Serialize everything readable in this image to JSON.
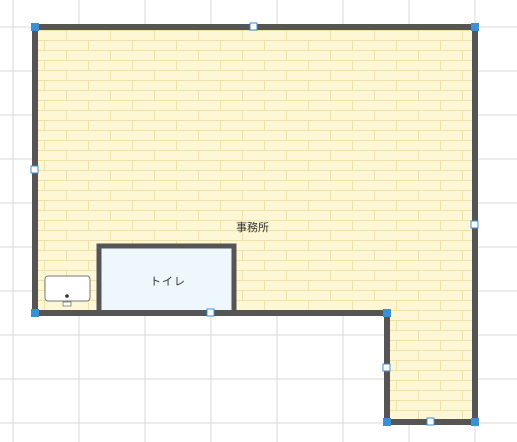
{
  "rooms": {
    "office": {
      "label": "事務所"
    },
    "toilet": {
      "label": "トイレ"
    }
  },
  "colors": {
    "grid": "#d9d9d9",
    "wall": "#555555",
    "brick_fill": "#fdf7d6",
    "brick_line": "#efe2a6",
    "toilet_fill": "#eef7fb",
    "handle": "#3b8fd6",
    "handle_white": "#ffffff"
  },
  "icons": {
    "sink": "sink-icon",
    "handle": "resize-handle"
  }
}
